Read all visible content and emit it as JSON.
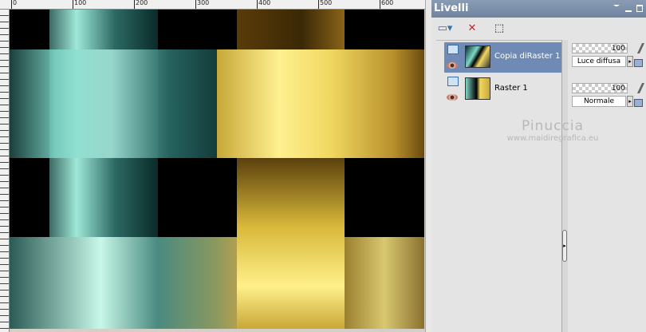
{
  "ruler": {
    "ticks": [
      "0",
      "100",
      "200",
      "300",
      "400",
      "500",
      "600"
    ]
  },
  "panel": {
    "title": "Livelli",
    "toolbar": [
      {
        "icon": "new-layer-icon"
      },
      {
        "icon": "delete-layer-icon"
      },
      {
        "icon": "edit-selection-icon"
      }
    ],
    "layers": [
      {
        "name": "Copia diRaster 1",
        "selected": true,
        "opacity": "100",
        "blend": "Luce diffusa"
      },
      {
        "name": "Raster 1",
        "selected": false,
        "opacity": "100",
        "blend": "Normale"
      }
    ]
  },
  "watermark": {
    "name": "Pinuccia",
    "url": "www.maidiregrafica.eu"
  },
  "colors": {
    "teal": "#2e6e68",
    "gold": "#d8b838",
    "selection": "#6f8bb5"
  }
}
